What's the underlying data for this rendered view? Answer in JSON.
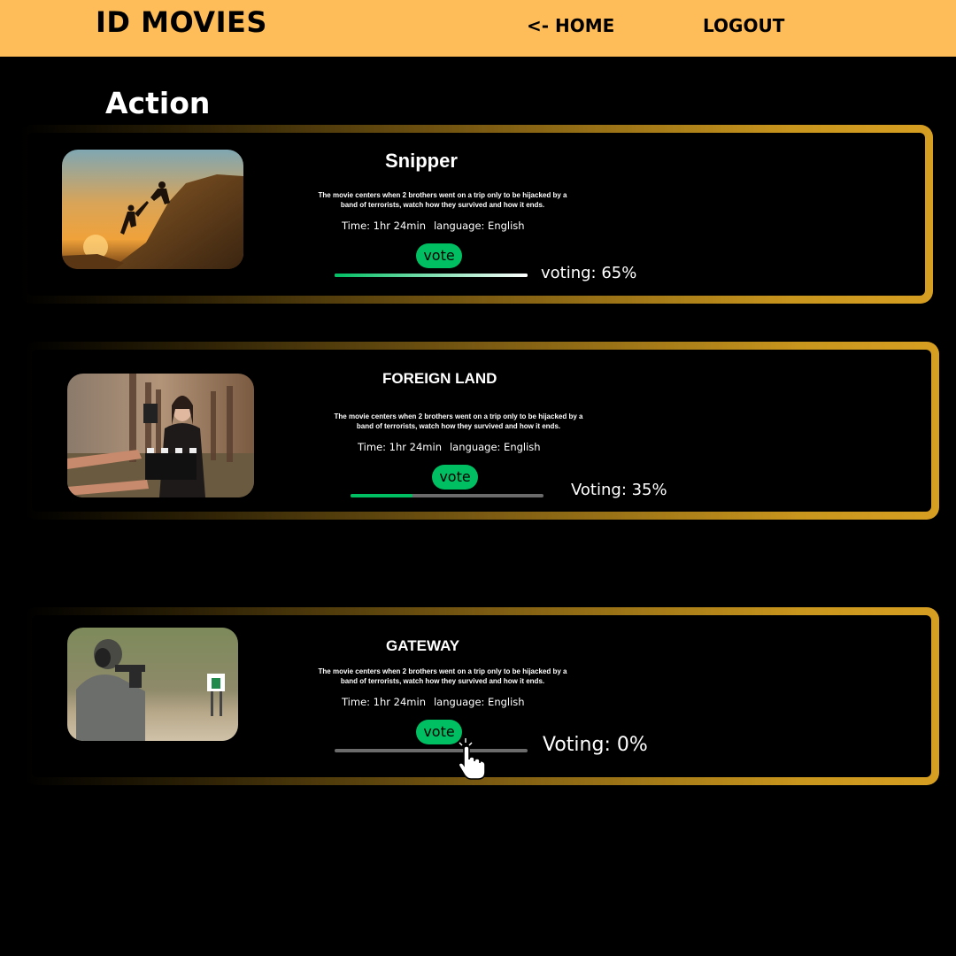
{
  "header": {
    "logo": "ID MOVIES",
    "home_label": "<- HOME",
    "logout_label": "LOGOUT"
  },
  "section": {
    "title": "Action"
  },
  "movies": [
    {
      "title": "Snipper",
      "description": "The movie centers when 2 brothers went on a trip only to be hijacked by a band of terrorists, watch how they survived and how it ends.",
      "time": "Time: 1hr 24min",
      "language": "language: English",
      "vote_label": "vote",
      "voting_text": "voting: 65%",
      "voting_percent": 65
    },
    {
      "title": "FOREIGN LAND",
      "description": "The movie centers when 2 brothers went on a trip only to be hijacked by a band of terrorists, watch how they survived and how it ends.",
      "time": "Time: 1hr 24min",
      "language": "language: English",
      "vote_label": "vote",
      "voting_text": "Voting: 35%",
      "voting_percent": 35
    },
    {
      "title": "GATEWAY",
      "description": "The movie centers when 2 brothers went on a trip only to be hijacked by a band of terrorists, watch how they survived and how it ends.",
      "time": "Time: 1hr 24min",
      "language": "language: English",
      "vote_label": "vote",
      "voting_text": "Voting: 0%",
      "voting_percent": 0
    }
  ],
  "colors": {
    "header_bg": "#ffbd59",
    "vote_green": "#00bf63",
    "card_border_gold": "#d69f22",
    "page_bg": "#000000"
  }
}
